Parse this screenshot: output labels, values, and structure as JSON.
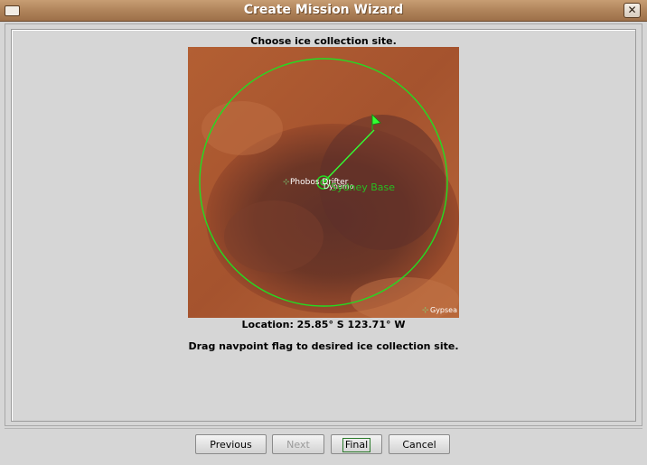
{
  "window": {
    "title": "Create Mission Wizard",
    "close_glyph": "✕"
  },
  "wizard": {
    "prompt": "Choose ice collection site.",
    "location": "Location: 25.85° S 123.71° W",
    "instructions": "Drag navpoint flag to desired ice collection site."
  },
  "map": {
    "labels": {
      "phobos": "Phobos Drifter",
      "overlap": "Dynamo",
      "base": "Sydney Base",
      "gypsea": "Gypsea"
    },
    "colors": {
      "range_circle": "#22dd22",
      "navpoint": "#33ff33",
      "label": "#ffffff",
      "base_label": "#22cc22"
    }
  },
  "buttons": {
    "previous": "Previous",
    "next": "Next",
    "final": "Final",
    "cancel": "Cancel"
  },
  "icons": {
    "window_menu": "window-menu-icon",
    "close": "close-icon",
    "flag": "flag-icon"
  }
}
